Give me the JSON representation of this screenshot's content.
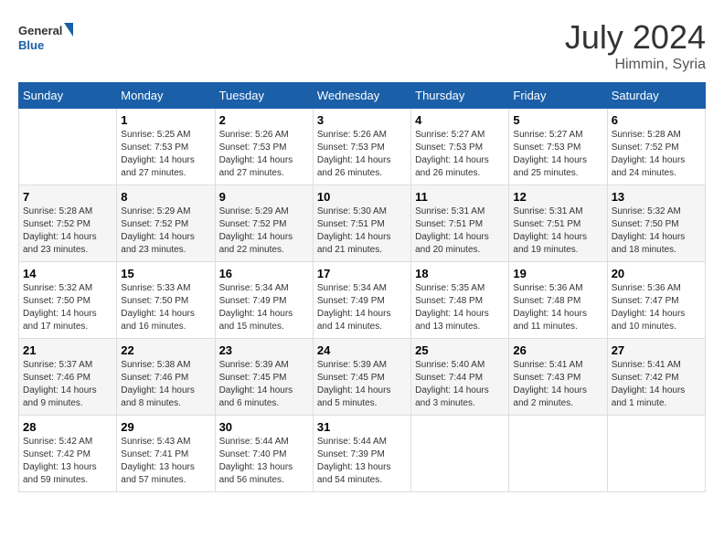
{
  "logo": {
    "line1": "General",
    "line2": "Blue"
  },
  "title": "July 2024",
  "location": "Himmin, Syria",
  "weekdays": [
    "Sunday",
    "Monday",
    "Tuesday",
    "Wednesday",
    "Thursday",
    "Friday",
    "Saturday"
  ],
  "weeks": [
    [
      {
        "day": "",
        "info": ""
      },
      {
        "day": "1",
        "info": "Sunrise: 5:25 AM\nSunset: 7:53 PM\nDaylight: 14 hours\nand 27 minutes."
      },
      {
        "day": "2",
        "info": "Sunrise: 5:26 AM\nSunset: 7:53 PM\nDaylight: 14 hours\nand 27 minutes."
      },
      {
        "day": "3",
        "info": "Sunrise: 5:26 AM\nSunset: 7:53 PM\nDaylight: 14 hours\nand 26 minutes."
      },
      {
        "day": "4",
        "info": "Sunrise: 5:27 AM\nSunset: 7:53 PM\nDaylight: 14 hours\nand 26 minutes."
      },
      {
        "day": "5",
        "info": "Sunrise: 5:27 AM\nSunset: 7:53 PM\nDaylight: 14 hours\nand 25 minutes."
      },
      {
        "day": "6",
        "info": "Sunrise: 5:28 AM\nSunset: 7:52 PM\nDaylight: 14 hours\nand 24 minutes."
      }
    ],
    [
      {
        "day": "7",
        "info": "Sunrise: 5:28 AM\nSunset: 7:52 PM\nDaylight: 14 hours\nand 23 minutes."
      },
      {
        "day": "8",
        "info": "Sunrise: 5:29 AM\nSunset: 7:52 PM\nDaylight: 14 hours\nand 23 minutes."
      },
      {
        "day": "9",
        "info": "Sunrise: 5:29 AM\nSunset: 7:52 PM\nDaylight: 14 hours\nand 22 minutes."
      },
      {
        "day": "10",
        "info": "Sunrise: 5:30 AM\nSunset: 7:51 PM\nDaylight: 14 hours\nand 21 minutes."
      },
      {
        "day": "11",
        "info": "Sunrise: 5:31 AM\nSunset: 7:51 PM\nDaylight: 14 hours\nand 20 minutes."
      },
      {
        "day": "12",
        "info": "Sunrise: 5:31 AM\nSunset: 7:51 PM\nDaylight: 14 hours\nand 19 minutes."
      },
      {
        "day": "13",
        "info": "Sunrise: 5:32 AM\nSunset: 7:50 PM\nDaylight: 14 hours\nand 18 minutes."
      }
    ],
    [
      {
        "day": "14",
        "info": "Sunrise: 5:32 AM\nSunset: 7:50 PM\nDaylight: 14 hours\nand 17 minutes."
      },
      {
        "day": "15",
        "info": "Sunrise: 5:33 AM\nSunset: 7:50 PM\nDaylight: 14 hours\nand 16 minutes."
      },
      {
        "day": "16",
        "info": "Sunrise: 5:34 AM\nSunset: 7:49 PM\nDaylight: 14 hours\nand 15 minutes."
      },
      {
        "day": "17",
        "info": "Sunrise: 5:34 AM\nSunset: 7:49 PM\nDaylight: 14 hours\nand 14 minutes."
      },
      {
        "day": "18",
        "info": "Sunrise: 5:35 AM\nSunset: 7:48 PM\nDaylight: 14 hours\nand 13 minutes."
      },
      {
        "day": "19",
        "info": "Sunrise: 5:36 AM\nSunset: 7:48 PM\nDaylight: 14 hours\nand 11 minutes."
      },
      {
        "day": "20",
        "info": "Sunrise: 5:36 AM\nSunset: 7:47 PM\nDaylight: 14 hours\nand 10 minutes."
      }
    ],
    [
      {
        "day": "21",
        "info": "Sunrise: 5:37 AM\nSunset: 7:46 PM\nDaylight: 14 hours\nand 9 minutes."
      },
      {
        "day": "22",
        "info": "Sunrise: 5:38 AM\nSunset: 7:46 PM\nDaylight: 14 hours\nand 8 minutes."
      },
      {
        "day": "23",
        "info": "Sunrise: 5:39 AM\nSunset: 7:45 PM\nDaylight: 14 hours\nand 6 minutes."
      },
      {
        "day": "24",
        "info": "Sunrise: 5:39 AM\nSunset: 7:45 PM\nDaylight: 14 hours\nand 5 minutes."
      },
      {
        "day": "25",
        "info": "Sunrise: 5:40 AM\nSunset: 7:44 PM\nDaylight: 14 hours\nand 3 minutes."
      },
      {
        "day": "26",
        "info": "Sunrise: 5:41 AM\nSunset: 7:43 PM\nDaylight: 14 hours\nand 2 minutes."
      },
      {
        "day": "27",
        "info": "Sunrise: 5:41 AM\nSunset: 7:42 PM\nDaylight: 14 hours\nand 1 minute."
      }
    ],
    [
      {
        "day": "28",
        "info": "Sunrise: 5:42 AM\nSunset: 7:42 PM\nDaylight: 13 hours\nand 59 minutes."
      },
      {
        "day": "29",
        "info": "Sunrise: 5:43 AM\nSunset: 7:41 PM\nDaylight: 13 hours\nand 57 minutes."
      },
      {
        "day": "30",
        "info": "Sunrise: 5:44 AM\nSunset: 7:40 PM\nDaylight: 13 hours\nand 56 minutes."
      },
      {
        "day": "31",
        "info": "Sunrise: 5:44 AM\nSunset: 7:39 PM\nDaylight: 13 hours\nand 54 minutes."
      },
      {
        "day": "",
        "info": ""
      },
      {
        "day": "",
        "info": ""
      },
      {
        "day": "",
        "info": ""
      }
    ]
  ]
}
